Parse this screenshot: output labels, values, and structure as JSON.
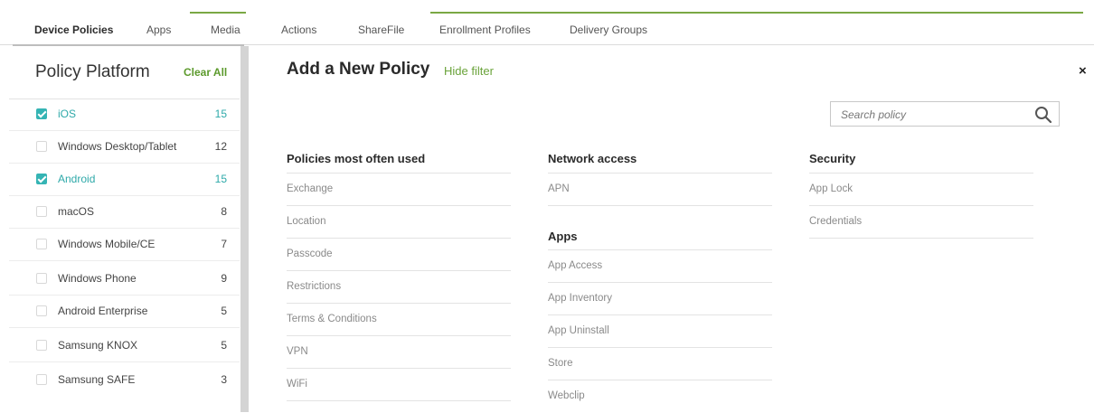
{
  "tabs": [
    {
      "label": "Device Policies",
      "active": true
    },
    {
      "label": "Apps"
    },
    {
      "label": "Media"
    },
    {
      "label": "Actions"
    },
    {
      "label": "ShareFile"
    },
    {
      "label": "Enrollment Profiles"
    },
    {
      "label": "Delivery Groups"
    }
  ],
  "sidebar": {
    "title": "Policy Platform",
    "clear_all": "Clear All",
    "platforms": [
      {
        "label": "iOS",
        "count": "15",
        "checked": true
      },
      {
        "label": "Windows Desktop/Tablet",
        "count": "12",
        "checked": false
      },
      {
        "label": "Android",
        "count": "15",
        "checked": true
      },
      {
        "label": "macOS",
        "count": "8",
        "checked": false
      },
      {
        "label": "Windows Mobile/CE",
        "count": "7",
        "checked": false
      },
      {
        "label": "Windows Phone",
        "count": "9",
        "checked": false
      },
      {
        "label": "Android Enterprise",
        "count": "5",
        "checked": false
      },
      {
        "label": "Samsung KNOX",
        "count": "5",
        "checked": false
      },
      {
        "label": "Samsung SAFE",
        "count": "3",
        "checked": false
      }
    ]
  },
  "main": {
    "title": "Add a New Policy",
    "hide_filter": "Hide filter",
    "close": "×",
    "search_placeholder": "Search policy",
    "sections": {
      "most_used": {
        "heading": "Policies most often used",
        "items": [
          "Exchange",
          "Location",
          "Passcode",
          "Restrictions",
          "Terms & Conditions",
          "VPN",
          "WiFi"
        ]
      },
      "network": {
        "heading": "Network access",
        "items": [
          "APN"
        ]
      },
      "apps": {
        "heading": "Apps",
        "items": [
          "App Access",
          "App Inventory",
          "App Uninstall",
          "Store",
          "Webclip"
        ]
      },
      "security": {
        "heading": "Security",
        "items": [
          "App Lock",
          "Credentials"
        ]
      }
    }
  },
  "colors": {
    "accent_green": "#6aa33a",
    "check_teal": "#35b4b4"
  }
}
